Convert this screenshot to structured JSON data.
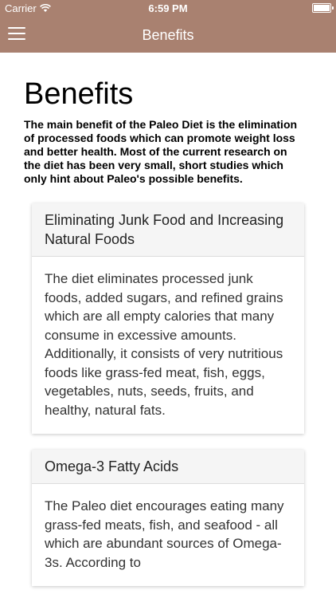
{
  "status_bar": {
    "carrier": "Carrier",
    "time": "6:59 PM"
  },
  "nav": {
    "title": "Benefits",
    "menu_icon": "hamburger-menu-icon"
  },
  "page": {
    "heading": "Benefits",
    "intro": "The main benefit of the Paleo Diet is the elimination of processed foods which can promote weight loss and better health. Most of the current research on the diet has been very small, short studies which only hint about Paleo's possible benefits."
  },
  "cards": [
    {
      "title": "Eliminating Junk Food and Increasing Natural Foods",
      "body": "The diet eliminates processed junk foods, added sugars, and refined grains which are all empty calories that many consume in excessive amounts. Additionally, it consists of very nutritious foods like grass-fed meat, fish, eggs, vegetables, nuts, seeds, fruits, and healthy, natural fats."
    },
    {
      "title": "Omega-3 Fatty Acids",
      "body": "The Paleo diet encourages eating many grass-fed meats, fish, and seafood - all which are abundant sources of Omega-3s. According to"
    }
  ],
  "colors": {
    "bar_background": "#a98170",
    "bar_text": "#ffffff",
    "card_header_bg": "#f5f5f5"
  }
}
